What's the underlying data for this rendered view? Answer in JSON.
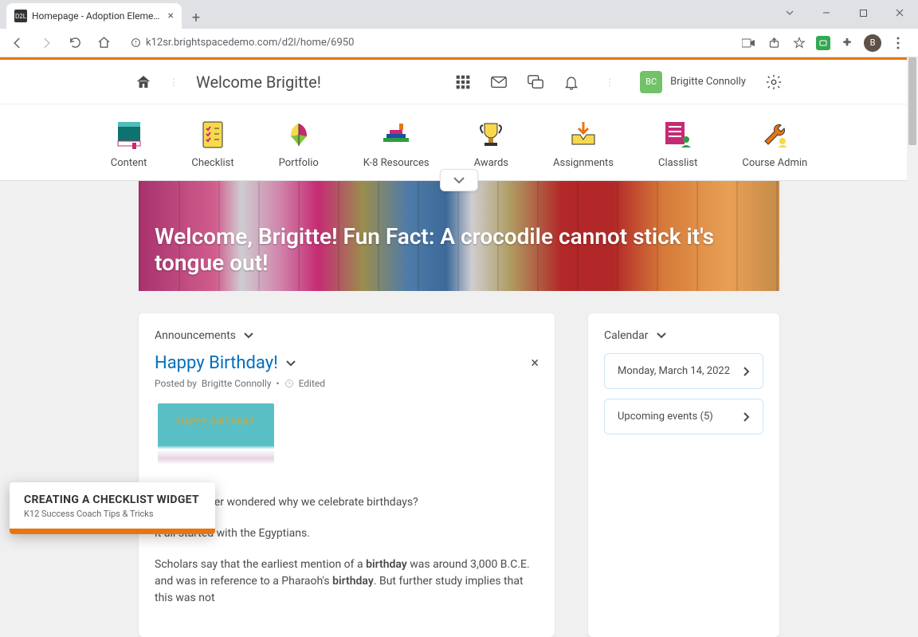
{
  "browser": {
    "tab_title": "Homepage - Adoption Elementa…",
    "url": "k12sr.brightspacedemo.com/d2l/home/6950",
    "avatar_initial": "B"
  },
  "header": {
    "page_title": "Welcome Brigitte!",
    "user_initials": "BC",
    "user_name": "Brigitte Connolly"
  },
  "nav": {
    "items": [
      {
        "label": "Content"
      },
      {
        "label": "Checklist"
      },
      {
        "label": "Portfolio"
      },
      {
        "label": "K-8 Resources"
      },
      {
        "label": "Awards"
      },
      {
        "label": "Assignments"
      },
      {
        "label": "Classlist"
      },
      {
        "label": "Course Admin"
      }
    ]
  },
  "banner": {
    "text": "Welcome, Brigitte! Fun Fact: A crocodile cannot stick it's tongue out!"
  },
  "announcements": {
    "widget_title": "Announcements",
    "post_title": "Happy Birthday!",
    "posted_by_prefix": "Posted by ",
    "author": "Brigitte Connolly",
    "edited_label": "Edited",
    "body_p1": "Have you ever wondered why we celebrate birthdays?",
    "body_p2": "It all started with the Egyptians.",
    "body_p3_a": "Scholars say that the earliest mention of a ",
    "body_p3_b": "birthday",
    "body_p3_c": " was around 3,000 B.C.E. and was in reference to a Pharaoh's ",
    "body_p3_d": "birthday",
    "body_p3_e": ". But further study implies that this was not"
  },
  "calendar": {
    "widget_title": "Calendar",
    "date": "Monday, March 14, 2022",
    "upcoming": "Upcoming events (5)"
  },
  "overlay": {
    "title": "CREATING A CHECKLIST WIDGET",
    "subtitle": "K12 Success Coach Tips & Tricks"
  }
}
